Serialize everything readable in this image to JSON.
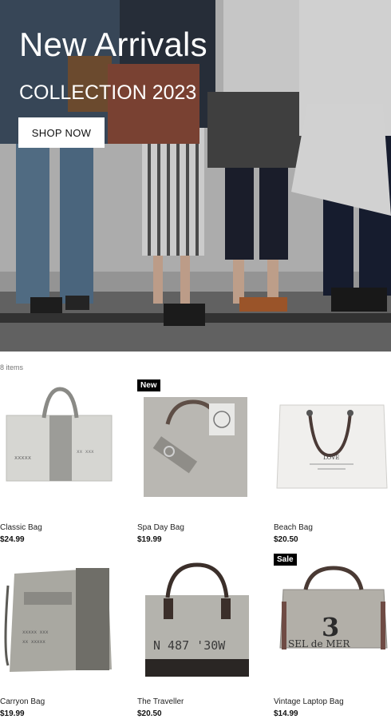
{
  "hero": {
    "title": "New Arrivals",
    "subtitle": "COLLECTION 2023",
    "button_label": "SHOP NOW"
  },
  "listing": {
    "count_text": "8 items",
    "products": [
      {
        "name": "Classic Bag",
        "price": "$24.99",
        "badge": ""
      },
      {
        "name": "Spa Day Bag",
        "price": "$19.99",
        "badge": "New"
      },
      {
        "name": "Beach Bag",
        "price": "$20.50",
        "badge": ""
      },
      {
        "name": "Carryon Bag",
        "price": "$19.99",
        "badge": ""
      },
      {
        "name": "The Traveller",
        "price": "$20.50",
        "badge": ""
      },
      {
        "name": "Vintage Laptop Bag",
        "price": "$14.99",
        "badge": "Sale"
      }
    ],
    "product_prints": {
      "beach_bag": "LOVE",
      "traveller": "N 487 '30W",
      "laptop_number": "3",
      "laptop_text": "SEL de MER"
    }
  }
}
